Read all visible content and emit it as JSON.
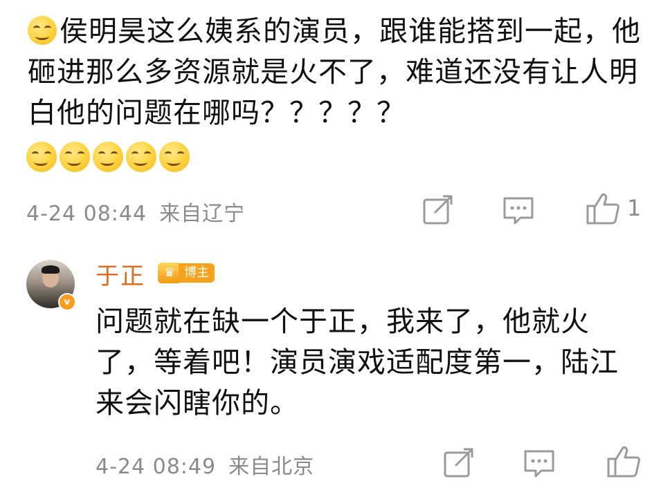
{
  "comment1": {
    "text": "侯明昊这么姨系的演员，跟谁能搭到一起，他砸进那么多资源就是火不了，难道还没有让人明白他的问题在哪吗？？？？？",
    "leading_emoji": "smirk-emoji",
    "trailing_emoji_count": 5,
    "timestamp": "4-24 08:44",
    "location": "来自辽宁",
    "like_count": "1",
    "icons": [
      "repost-icon",
      "comment-icon",
      "like-icon"
    ]
  },
  "reply": {
    "username": "于正",
    "badge": "博主",
    "verified_mark": "v",
    "text": "问题就在缺一个于正，我来了，他就火了，等着吧！演员演戏适配度第一，陆江来会闪瞎你的。",
    "timestamp": "4-24 08:49",
    "location": "来自北京",
    "icons": [
      "repost-icon",
      "comment-icon",
      "like-icon"
    ]
  },
  "colors": {
    "username": "#e36b1b",
    "meta": "#8a8a8a",
    "badge": "#f7a21b",
    "text": "#111111"
  }
}
